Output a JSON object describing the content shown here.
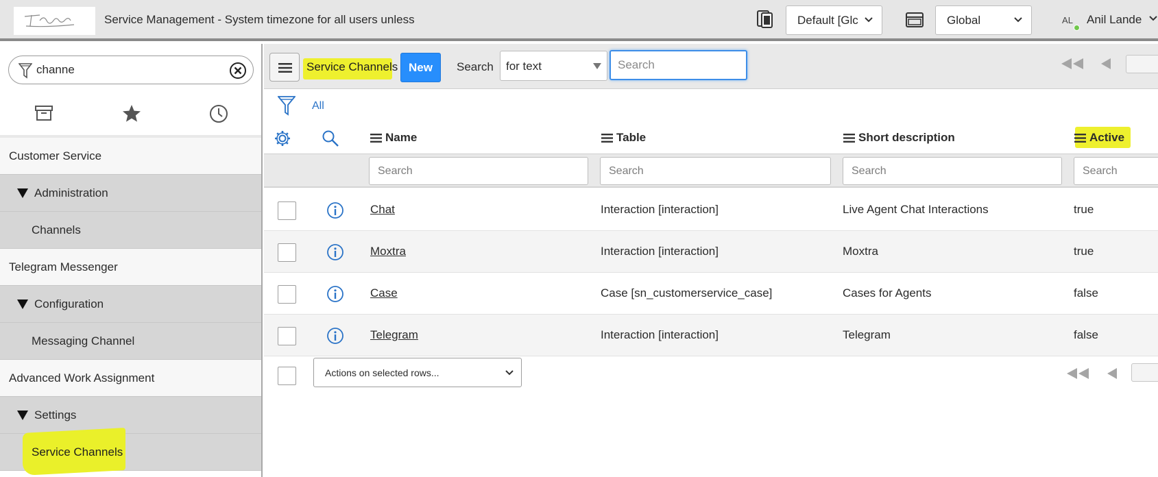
{
  "header": {
    "app_title": "Service Management - System timezone for all users unless",
    "update_set": "Default [Glc",
    "scope": "Global",
    "user_initials": "AL",
    "user_name": "Anil Lande"
  },
  "nav": {
    "filter_value": "channe",
    "items": [
      {
        "type": "app",
        "label": "Customer Service"
      },
      {
        "type": "section",
        "label": "Administration"
      },
      {
        "type": "module",
        "label": "Channels"
      },
      {
        "type": "app",
        "label": "Telegram Messenger"
      },
      {
        "type": "section",
        "label": "Configuration"
      },
      {
        "type": "module",
        "label": "Messaging Channel"
      },
      {
        "type": "app",
        "label": "Advanced Work Assignment"
      },
      {
        "type": "section",
        "label": "Settings"
      },
      {
        "type": "module",
        "label": "Service Channels"
      }
    ]
  },
  "list": {
    "title": "Service Channels",
    "new_label": "New",
    "search_label": "Search",
    "search_type": "for text",
    "search_placeholder": "Search",
    "breadcrumb_all": "All",
    "columns": [
      "Name",
      "Table",
      "Short description",
      "Active"
    ],
    "column_search_placeholder": "Search",
    "rows": [
      {
        "name": "Chat",
        "table": "Interaction [interaction]",
        "short_description": "Live Agent Chat Interactions",
        "active": "true"
      },
      {
        "name": "Moxtra",
        "table": "Interaction [interaction]",
        "short_description": "Moxtra",
        "active": "true"
      },
      {
        "name": "Case",
        "table": "Case [sn_customerservice_case]",
        "short_description": "Cases for Agents",
        "active": "false"
      },
      {
        "name": "Telegram",
        "table": "Interaction [interaction]",
        "short_description": "Telegram",
        "active": "false"
      }
    ],
    "actions_label": "Actions on selected rows..."
  },
  "colors": {
    "accent": "#278efc",
    "highlight": "#eef02e",
    "link": "#2a73c7"
  },
  "icons": {
    "update_set": "update-set-icon",
    "scope": "application-scope-icon",
    "filter": "filter-icon",
    "clear": "clear-circle-icon",
    "all_apps": "archive-box-icon",
    "favorites": "star-icon",
    "history": "clock-icon",
    "settings": "gear-icon",
    "column_search": "magnifier-icon",
    "info": "info-circle-icon"
  }
}
